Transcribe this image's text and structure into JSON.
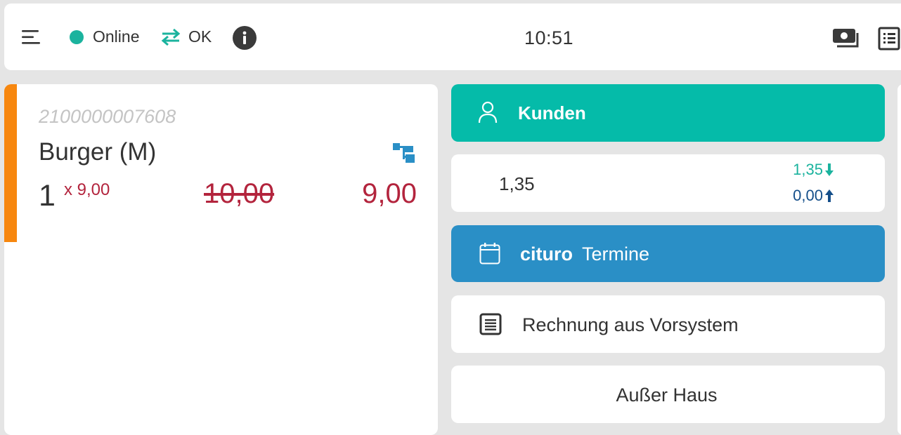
{
  "topbar": {
    "status_online": "Online",
    "status_sync": "OK",
    "clock": "10:51",
    "icons": [
      "menu-icon",
      "online-dot-icon",
      "sync-arrows-icon",
      "info-icon",
      "cash-icon",
      "receipt-list-icon"
    ]
  },
  "order_item": {
    "barcode": "2100000007608",
    "name": "Burger (M)",
    "quantity": "1",
    "unit_price": "x 9,00",
    "original_price": "10,00",
    "price": "9,00"
  },
  "actions": {
    "kunden": "Kunden",
    "balance_main": "1,35",
    "balance_in": "1,35",
    "balance_out": "0,00",
    "cituro_brand": "cituro",
    "cituro_label": "Termine",
    "rechnung": "Rechnung aus Vorsystem",
    "ausser_haus": "Außer Haus"
  },
  "colors": {
    "accent_orange": "#f7870f",
    "teal": "#05bba9",
    "blue": "#2a8fc6",
    "price_red": "#b3243d",
    "dark_blue": "#154f8a"
  }
}
